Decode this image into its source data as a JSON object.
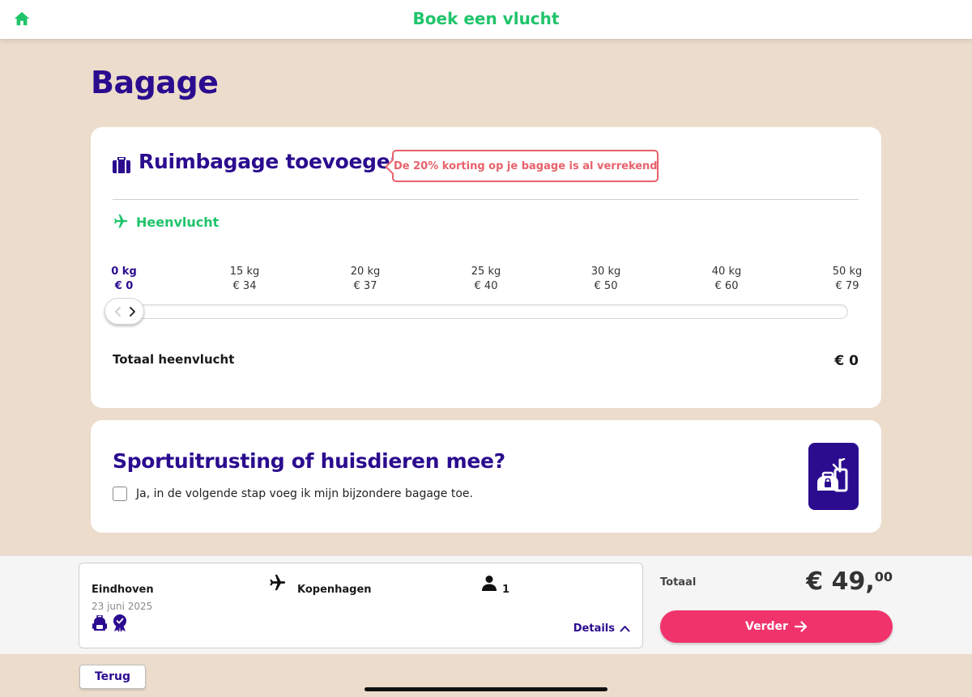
{
  "header": {
    "title": "Boek een vlucht",
    "home_icon": "home-icon"
  },
  "page": {
    "title": "Bagage"
  },
  "hold_baggage": {
    "title": "Ruimbagage toevoegen",
    "icon": "suitcase-icon",
    "discount_badge": "De 20% korting op je bagage is al verrekend",
    "outbound_label": "Heenvlucht",
    "options": [
      {
        "weight": "0 kg",
        "price": "€ 0",
        "selected": true
      },
      {
        "weight": "15 kg",
        "price": "€ 34",
        "selected": false
      },
      {
        "weight": "20 kg",
        "price": "€ 37",
        "selected": false
      },
      {
        "weight": "25 kg",
        "price": "€ 40",
        "selected": false
      },
      {
        "weight": "30 kg",
        "price": "€ 50",
        "selected": false
      },
      {
        "weight": "40 kg",
        "price": "€ 60",
        "selected": false
      },
      {
        "weight": "50 kg",
        "price": "€ 79",
        "selected": false
      }
    ],
    "slider_selected_index": 0,
    "total_label": "Totaal heenvlucht",
    "total_value": "€ 0"
  },
  "special_baggage": {
    "title": "Sportuitrusting of huisdieren mee?",
    "checkbox_label": "Ja, in de volgende stap voeg ik mijn bijzondere bagage toe.",
    "checked": false,
    "icon": "special-baggage-icon"
  },
  "summary": {
    "origin": "Eindhoven",
    "date": "23 juni 2025",
    "destination": "Kopenhagen",
    "passengers": "1",
    "details_label": "Details",
    "total_label": "Totaal",
    "price_main": "€ 49,",
    "price_cents": "00",
    "next_label": "Verder"
  },
  "footer": {
    "back_label": "Terug"
  },
  "colors": {
    "brand_purple": "#2b0c8f",
    "brand_green": "#1fc46a",
    "accent_pink": "#f1336c",
    "alert_red": "#e8616b",
    "background": "#ecdccb"
  }
}
